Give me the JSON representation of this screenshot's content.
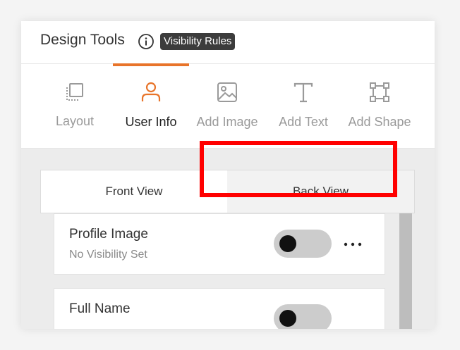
{
  "header": {
    "title": "Design Tools",
    "badge": "Visibility Rules",
    "info_icon": "info-circle-icon"
  },
  "toolbar": {
    "active_tab": "User Info",
    "accent_color": "#e8742a",
    "items": [
      {
        "label": "Layout",
        "icon": "layout-icon"
      },
      {
        "label": "User Info",
        "icon": "user-icon"
      },
      {
        "label": "Add Image",
        "icon": "image-icon"
      },
      {
        "label": "Add Text",
        "icon": "text-icon"
      },
      {
        "label": "Add Shape",
        "icon": "shape-icon"
      }
    ]
  },
  "view_tabs": {
    "front": "Front View",
    "back": "Back View",
    "selected": "Back View",
    "highlight_color": "#ff0000"
  },
  "fields": [
    {
      "name": "Profile Image",
      "status": "No Visibility Set",
      "toggle_on": false
    },
    {
      "name": "Full Name",
      "toggle_on": false
    }
  ]
}
